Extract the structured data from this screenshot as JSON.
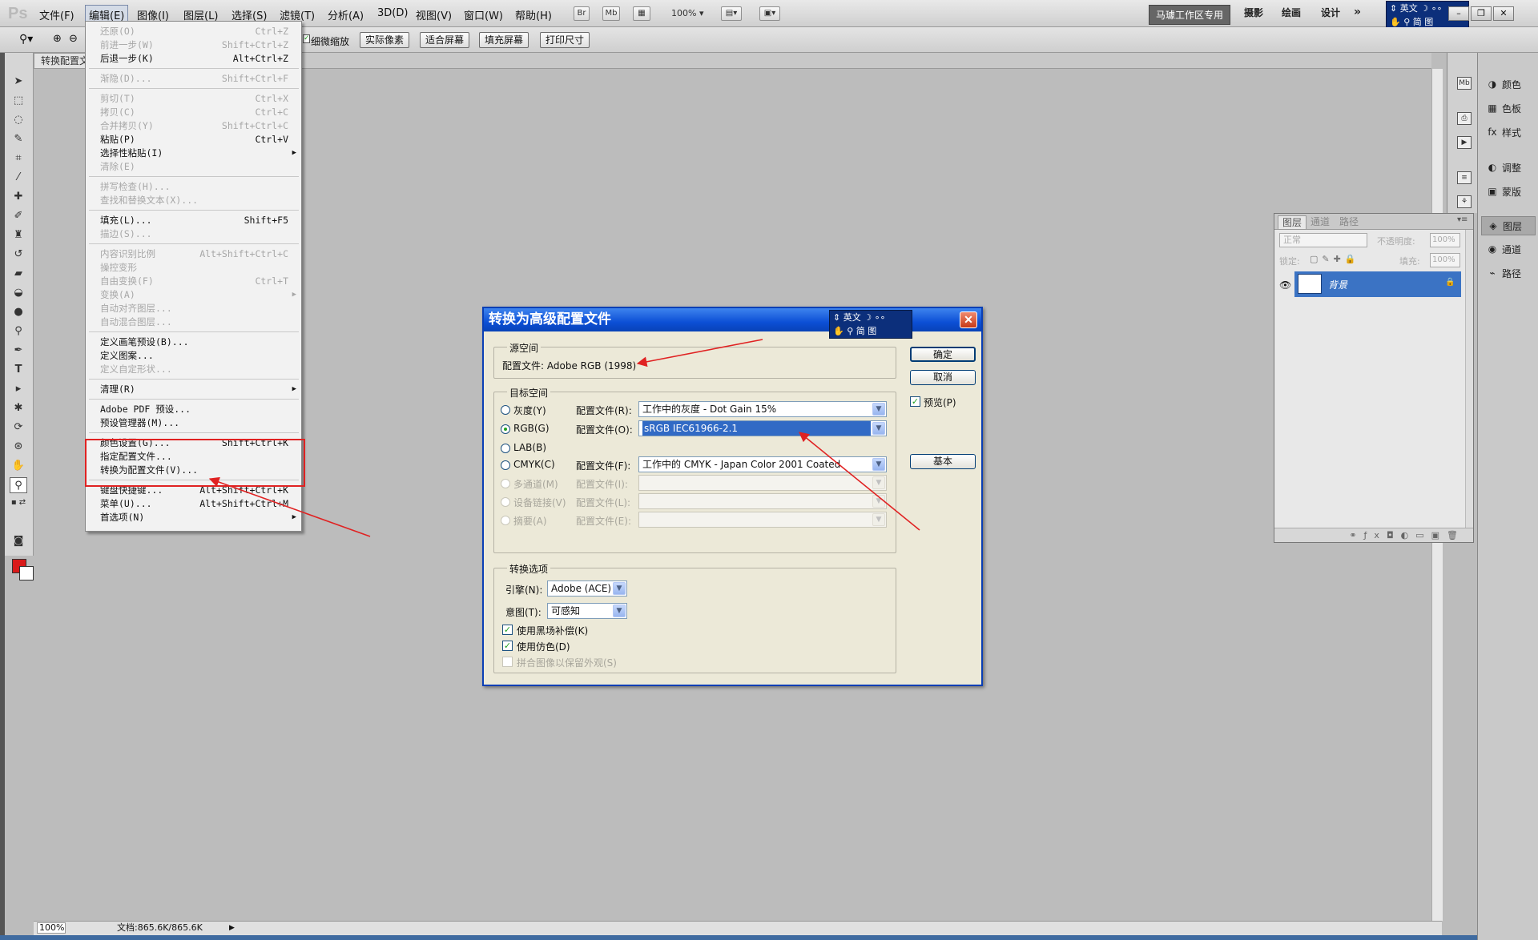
{
  "app": {
    "logo": "Ps",
    "menus": [
      "文件(F)",
      "编辑(E)",
      "图像(I)",
      "图层(L)",
      "选择(S)",
      "滤镜(T)",
      "分析(A)",
      "3D(D)",
      "视图(V)",
      "窗口(W)",
      "帮助(H)"
    ],
    "active_menu": "编辑(E)",
    "toolbar_badges": [
      "Br",
      "Mb"
    ],
    "zoom": "100%",
    "workspaces": {
      "active": "马璩工作区专用",
      "others": [
        "摄影",
        "绘画",
        "设计"
      ],
      "more": "»"
    }
  },
  "ime": {
    "lang": "英文",
    "row2": "简 图"
  },
  "options_bar": {
    "partial_label": "细微缩放",
    "buttons": [
      "实际像素",
      "适合屏幕",
      "填充屏幕",
      "打印尺寸"
    ]
  },
  "document": {
    "tab": "转换配置文件",
    "zoom": "100%",
    "doc_info": "文档:865.6K/865.6K"
  },
  "edit_menu": {
    "sections": [
      [
        {
          "label": "还原(O)",
          "shortcut": "Ctrl+Z",
          "disabled": true
        },
        {
          "label": "前进一步(W)",
          "shortcut": "Shift+Ctrl+Z",
          "disabled": true
        },
        {
          "label": "后退一步(K)",
          "shortcut": "Alt+Ctrl+Z",
          "disabled": false
        }
      ],
      [
        {
          "label": "渐隐(D)...",
          "shortcut": "Shift+Ctrl+F",
          "disabled": true
        }
      ],
      [
        {
          "label": "剪切(T)",
          "shortcut": "Ctrl+X",
          "disabled": true
        },
        {
          "label": "拷贝(C)",
          "shortcut": "Ctrl+C",
          "disabled": true
        },
        {
          "label": "合并拷贝(Y)",
          "shortcut": "Shift+Ctrl+C",
          "disabled": true
        },
        {
          "label": "粘贴(P)",
          "shortcut": "Ctrl+V",
          "disabled": false
        },
        {
          "label": "选择性粘贴(I)",
          "shortcut": "",
          "disabled": false,
          "submenu": true
        },
        {
          "label": "清除(E)",
          "shortcut": "",
          "disabled": true
        }
      ],
      [
        {
          "label": "拼写检查(H)...",
          "shortcut": "",
          "disabled": true
        },
        {
          "label": "查找和替换文本(X)...",
          "shortcut": "",
          "disabled": true
        }
      ],
      [
        {
          "label": "填充(L)...",
          "shortcut": "Shift+F5",
          "disabled": false
        },
        {
          "label": "描边(S)...",
          "shortcut": "",
          "disabled": true
        }
      ],
      [
        {
          "label": "内容识别比例",
          "shortcut": "Alt+Shift+Ctrl+C",
          "disabled": true
        },
        {
          "label": "操控变形",
          "shortcut": "",
          "disabled": true
        },
        {
          "label": "自由变换(F)",
          "shortcut": "Ctrl+T",
          "disabled": true
        },
        {
          "label": "变换(A)",
          "shortcut": "",
          "disabled": true,
          "submenu": true
        },
        {
          "label": "自动对齐图层...",
          "shortcut": "",
          "disabled": true
        },
        {
          "label": "自动混合图层...",
          "shortcut": "",
          "disabled": true
        }
      ],
      [
        {
          "label": "定义画笔预设(B)...",
          "shortcut": "",
          "disabled": false
        },
        {
          "label": "定义图案...",
          "shortcut": "",
          "disabled": false
        },
        {
          "label": "定义自定形状...",
          "shortcut": "",
          "disabled": true
        }
      ],
      [
        {
          "label": "清理(R)",
          "shortcut": "",
          "disabled": false,
          "submenu": true
        }
      ],
      [
        {
          "label": "Adobe PDF 预设...",
          "shortcut": "",
          "disabled": false
        },
        {
          "label": "预设管理器(M)...",
          "shortcut": "",
          "disabled": false
        }
      ],
      [
        {
          "label": "颜色设置(G)...",
          "shortcut": "Shift+Ctrl+K",
          "disabled": false
        },
        {
          "label": "指定配置文件...",
          "shortcut": "",
          "disabled": false
        },
        {
          "label": "转换为配置文件(V)...",
          "shortcut": "",
          "disabled": false
        }
      ],
      [
        {
          "label": "键盘快捷键...",
          "shortcut": "Alt+Shift+Ctrl+K",
          "disabled": false
        },
        {
          "label": "菜单(U)...",
          "shortcut": "Alt+Shift+Ctrl+M",
          "disabled": false
        },
        {
          "label": "首选项(N)",
          "shortcut": "",
          "disabled": false,
          "submenu": true
        }
      ]
    ]
  },
  "dialog": {
    "title": "转换为高级配置文件",
    "source": {
      "group": "源空间",
      "profile_label": "配置文件:",
      "profile_value": "Adobe RGB (1998)"
    },
    "destination": {
      "group": "目标空间",
      "rows": [
        {
          "mode": "灰度(Y)",
          "key": "Y",
          "label": "配置文件(R):",
          "value": "工作中的灰度 - Dot Gain 15%",
          "checked": false,
          "disabled": false
        },
        {
          "mode": "RGB(G)",
          "key": "G",
          "label": "配置文件(O):",
          "value": "sRGB IEC61966-2.1",
          "checked": true,
          "disabled": false,
          "selected": true
        },
        {
          "mode": "LAB(B)",
          "key": "B",
          "label": "",
          "value": "",
          "checked": false,
          "disabled": false,
          "no_combo": true
        },
        {
          "mode": "CMYK(C)",
          "key": "C",
          "label": "配置文件(F):",
          "value": "工作中的 CMYK - Japan Color 2001 Coated",
          "checked": false,
          "disabled": false
        },
        {
          "mode": "多通道(M)",
          "key": "M",
          "label": "配置文件(I):",
          "value": "",
          "checked": false,
          "disabled": true
        },
        {
          "mode": "设备链接(V)",
          "key": "V",
          "label": "配置文件(L):",
          "value": "",
          "checked": false,
          "disabled": true
        },
        {
          "mode": "摘要(A)",
          "key": "A",
          "label": "配置文件(E):",
          "value": "",
          "checked": false,
          "disabled": true
        }
      ]
    },
    "conversion": {
      "group": "转换选项",
      "engine_label": "引擎(N):",
      "engine": "Adobe (ACE)",
      "intent_label": "意图(T):",
      "intent": "可感知",
      "black_point": {
        "label": "使用黑场补偿(K)",
        "checked": true
      },
      "dither": {
        "label": "使用仿色(D)",
        "checked": true
      },
      "flatten": {
        "label": "拼合图像以保留外观(S)",
        "checked": false,
        "disabled": true
      }
    },
    "buttons": {
      "ok": "确定",
      "cancel": "取消",
      "basic": "基本"
    },
    "preview": {
      "label": "预览(P)",
      "checked": true
    },
    "close_glyph": "✕"
  },
  "layers_panel": {
    "tabs": [
      "图层",
      "通道",
      "路径"
    ],
    "blend_mode": "正常",
    "opacity_label": "不透明度:",
    "opacity": "100%",
    "lock_label": "锁定:",
    "fill_label": "填充:",
    "fill": "100%",
    "layer_name": "背景"
  },
  "right_dock": {
    "items": [
      "颜色",
      "色板",
      "样式",
      "调整",
      "蒙版",
      "图层",
      "通道",
      "路径"
    ],
    "selected": "图层"
  },
  "colors": {
    "foreground": "#d91a1a",
    "background": "#ffffff",
    "dialog_title": "#0c4fd6",
    "selection": "#316ac5",
    "annotation": "#e02222"
  }
}
